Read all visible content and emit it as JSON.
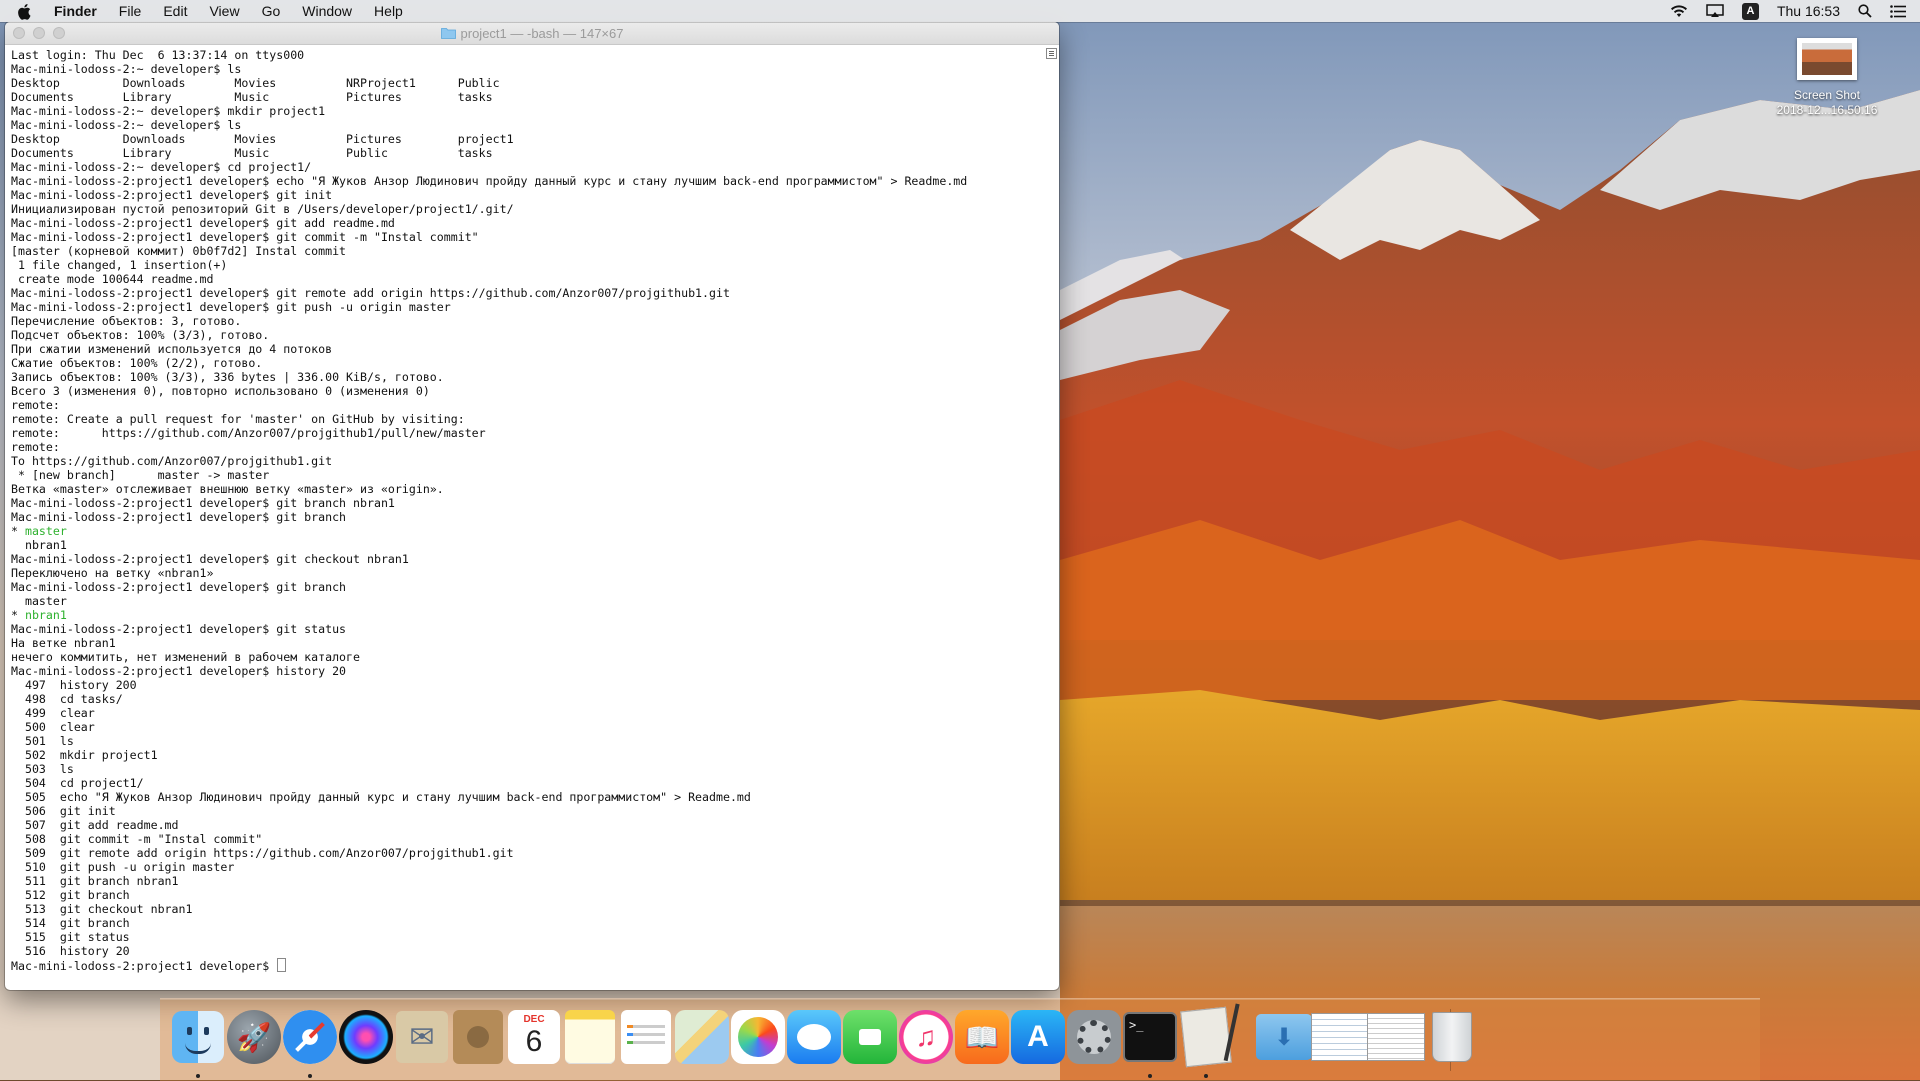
{
  "menubar": {
    "app_name": "Finder",
    "menus": [
      "File",
      "Edit",
      "View",
      "Go",
      "Window",
      "Help"
    ],
    "clock": "Thu 16:53",
    "input_source": "A"
  },
  "desktop_file": {
    "name": "Screen Shot",
    "date": "2018-12...16.50.16"
  },
  "terminal": {
    "title": "project1 — -bash — 147×67",
    "lines": [
      {
        "text": "Last login: Thu Dec  6 13:37:14 on ttys000"
      },
      {
        "text": "Mac-mini-lodoss-2:~ developer$ ls"
      },
      {
        "text": "Desktop         Downloads       Movies          NRProject1      Public"
      },
      {
        "text": "Documents       Library         Music           Pictures        tasks"
      },
      {
        "text": "Mac-mini-lodoss-2:~ developer$ mkdir project1"
      },
      {
        "text": "Mac-mini-lodoss-2:~ developer$ ls"
      },
      {
        "text": "Desktop         Downloads       Movies          Pictures        project1"
      },
      {
        "text": "Documents       Library         Music           Public          tasks"
      },
      {
        "text": "Mac-mini-lodoss-2:~ developer$ cd project1/"
      },
      {
        "text": "Mac-mini-lodoss-2:project1 developer$ echo \"Я Жуков Анзор Людинович пройду данный курс и стану лучшим back-end программистом\" > Readme.md"
      },
      {
        "text": "Mac-mini-lodoss-2:project1 developer$ git init"
      },
      {
        "text": "Инициализирован пустой репозиторий Git в /Users/developer/project1/.git/"
      },
      {
        "text": "Mac-mini-lodoss-2:project1 developer$ git add readme.md"
      },
      {
        "text": "Mac-mini-lodoss-2:project1 developer$ git commit -m \"Instal commit\""
      },
      {
        "text": "[master (корневой коммит) 0b0f7d2] Instal commit"
      },
      {
        "text": " 1 file changed, 1 insertion(+)"
      },
      {
        "text": " create mode 100644 readme.md"
      },
      {
        "text": "Mac-mini-lodoss-2:project1 developer$ git remote add origin https://github.com/Anzor007/projgithub1.git"
      },
      {
        "text": "Mac-mini-lodoss-2:project1 developer$ git push -u origin master"
      },
      {
        "text": "Перечисление объектов: 3, готово."
      },
      {
        "text": "Подсчет объектов: 100% (3/3), готово."
      },
      {
        "text": "При сжатии изменений используется до 4 потоков"
      },
      {
        "text": "Сжатие объектов: 100% (2/2), готово."
      },
      {
        "text": "Запись объектов: 100% (3/3), 336 bytes | 336.00 KiB/s, готово."
      },
      {
        "text": "Всего 3 (изменения 0), повторно использовано 0 (изменения 0)"
      },
      {
        "text": "remote:"
      },
      {
        "text": "remote: Create a pull request for 'master' on GitHub by visiting:"
      },
      {
        "text": "remote:      https://github.com/Anzor007/projgithub1/pull/new/master"
      },
      {
        "text": "remote:"
      },
      {
        "text": "To https://github.com/Anzor007/projgithub1.git"
      },
      {
        "text": " * [new branch]      master -> master"
      },
      {
        "text": "Ветка «master» отслеживает внешнюю ветку «master» из «origin»."
      },
      {
        "text": "Mac-mini-lodoss-2:project1 developer$ git branch nbran1"
      },
      {
        "text": "Mac-mini-lodoss-2:project1 developer$ git branch"
      },
      {
        "prefix": "* ",
        "text": "master",
        "green": true
      },
      {
        "text": "  nbran1"
      },
      {
        "text": "Mac-mini-lodoss-2:project1 developer$ git checkout nbran1"
      },
      {
        "text": "Переключено на ветку «nbran1»"
      },
      {
        "text": "Mac-mini-lodoss-2:project1 developer$ git branch"
      },
      {
        "text": "  master"
      },
      {
        "prefix": "* ",
        "text": "nbran1",
        "green": true
      },
      {
        "text": "Mac-mini-lodoss-2:project1 developer$ git status"
      },
      {
        "text": "На ветке nbran1"
      },
      {
        "text": "нечего коммитить, нет изменений в рабочем каталоге"
      },
      {
        "text": "Mac-mini-lodoss-2:project1 developer$ history 20"
      },
      {
        "text": "  497  history 200"
      },
      {
        "text": "  498  cd tasks/"
      },
      {
        "text": "  499  clear"
      },
      {
        "text": "  500  clear"
      },
      {
        "text": "  501  ls"
      },
      {
        "text": "  502  mkdir project1"
      },
      {
        "text": "  503  ls"
      },
      {
        "text": "  504  cd project1/"
      },
      {
        "text": "  505  echo \"Я Жуков Анзор Людинович пройду данный курс и стану лучшим back-end программистом\" > Readme.md"
      },
      {
        "text": "  506  git init"
      },
      {
        "text": "  507  git add readme.md"
      },
      {
        "text": "  508  git commit -m \"Instal commit\""
      },
      {
        "text": "  509  git remote add origin https://github.com/Anzor007/projgithub1.git"
      },
      {
        "text": "  510  git push -u origin master"
      },
      {
        "text": "  511  git branch nbran1"
      },
      {
        "text": "  512  git branch"
      },
      {
        "text": "  513  git checkout nbran1"
      },
      {
        "text": "  514  git branch"
      },
      {
        "text": "  515  git status"
      },
      {
        "text": "  516  history 20"
      }
    ],
    "prompt": "Mac-mini-lodoss-2:project1 developer$ "
  },
  "dock": {
    "calendar_month": "DEC",
    "calendar_day": "6",
    "items": [
      {
        "name": "finder",
        "running": true
      },
      {
        "name": "launchpad",
        "running": false
      },
      {
        "name": "safari",
        "running": true
      },
      {
        "name": "siri",
        "running": false
      },
      {
        "name": "mail",
        "running": false
      },
      {
        "name": "contacts",
        "running": false
      },
      {
        "name": "calendar",
        "running": false
      },
      {
        "name": "notes",
        "running": false
      },
      {
        "name": "reminders",
        "running": false
      },
      {
        "name": "maps",
        "running": false
      },
      {
        "name": "photos",
        "running": false
      },
      {
        "name": "messages",
        "running": false
      },
      {
        "name": "facetime",
        "running": false
      },
      {
        "name": "itunes",
        "running": false
      },
      {
        "name": "ibooks",
        "running": false
      },
      {
        "name": "app-store",
        "running": false
      },
      {
        "name": "system-preferences",
        "running": false
      },
      {
        "name": "terminal",
        "running": true
      },
      {
        "name": "script-editor",
        "running": true
      },
      {
        "name": "downloads-folder",
        "running": false
      },
      {
        "name": "documents-stack",
        "running": false
      },
      {
        "name": "screenshot-stack",
        "running": false
      },
      {
        "name": "trash",
        "running": false
      }
    ]
  },
  "colors": {
    "prompt_green": "#2fb12f",
    "menubar_bg": "#ececec"
  }
}
